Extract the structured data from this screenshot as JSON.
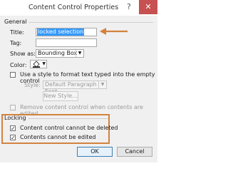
{
  "window": {
    "title": "Content Control Properties",
    "help_glyph": "?",
    "close_glyph": "✕"
  },
  "general": {
    "section_label": "General",
    "title_label": "Title:",
    "title_value": "locked selection",
    "tag_label": "Tag:",
    "tag_value": "",
    "show_as_label": "Show as:",
    "show_as_value": "Bounding Box",
    "color_label": "Color:",
    "use_style_label": "Use a style to format text typed into the empty control",
    "use_style_checked": false,
    "style_label": "Style:",
    "style_value": "Default Paragraph Font",
    "new_style_button": "New Style...",
    "remove_label": "Remove content control when contents are edited",
    "remove_checked": false
  },
  "locking": {
    "section_label": "Locking",
    "cannot_delete_label": "Content control cannot be deleted",
    "cannot_delete_checked": true,
    "cannot_edit_label": "Contents cannot be edited",
    "cannot_edit_checked": true
  },
  "buttons": {
    "ok": "OK",
    "cancel": "Cancel"
  },
  "colors": {
    "highlight_arrow": "#d2823e",
    "selection": "#3399ff",
    "close_button": "#c75050"
  },
  "icons": {
    "title_arrow": "arrow-left-icon",
    "paint_bucket": "paint-bucket-icon",
    "dropdown": "chevron-down-icon",
    "new_style": "new-style-icon"
  }
}
